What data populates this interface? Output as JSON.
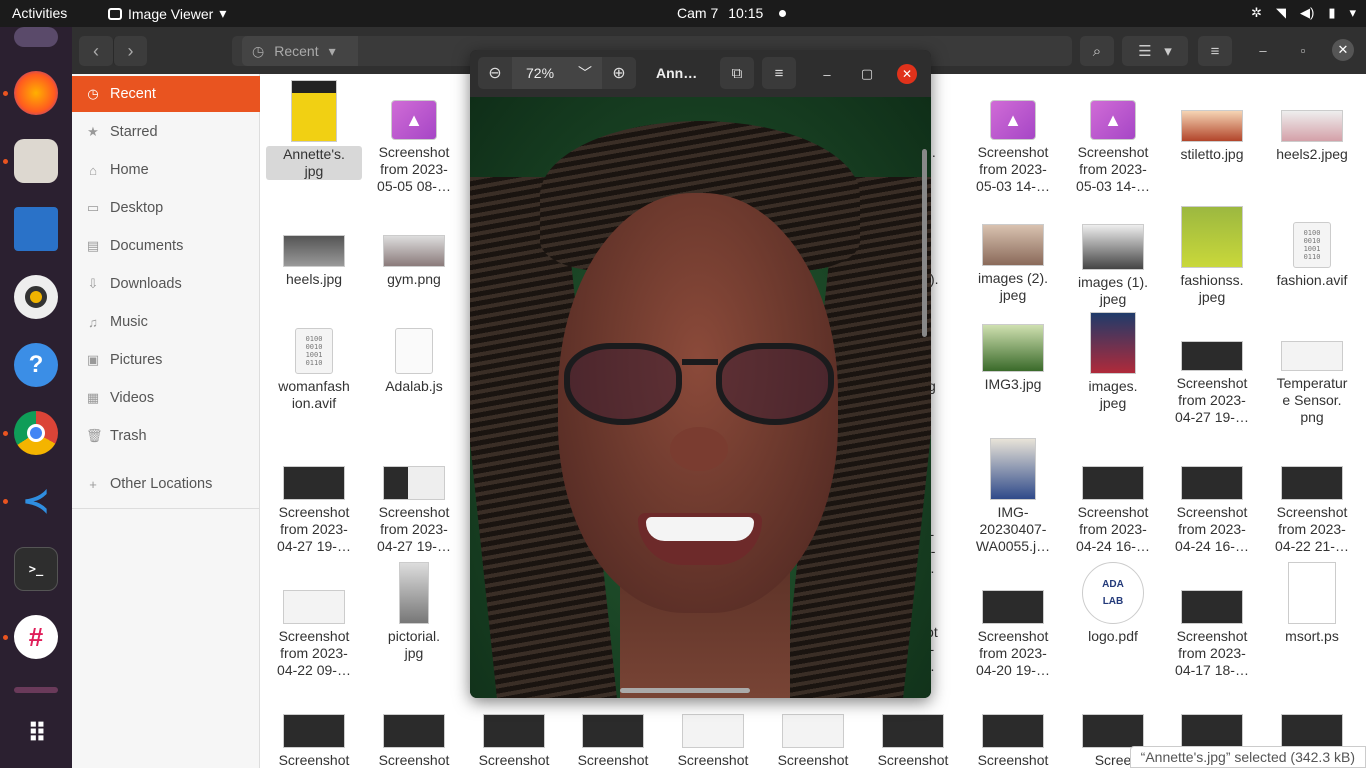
{
  "topbar": {
    "activities": "Activities",
    "app_name": "Image Viewer",
    "clock_label": "Cam 7",
    "clock_time": "10:15"
  },
  "dock": {
    "items": [
      "ubuntu-software-icon",
      "firefox-icon",
      "files-icon",
      "libreoffice-writer-icon",
      "rhythmbox-icon",
      "help-icon",
      "chrome-icon",
      "vscode-icon",
      "terminal-icon",
      "slack-icon",
      "app-grid-icon"
    ]
  },
  "files_window": {
    "location": "Recent",
    "sidebar": [
      {
        "label": "Recent",
        "icon": "clock-icon"
      },
      {
        "label": "Starred",
        "icon": "star-icon"
      },
      {
        "label": "Home",
        "icon": "home-icon"
      },
      {
        "label": "Desktop",
        "icon": "desktop-icon"
      },
      {
        "label": "Documents",
        "icon": "documents-icon"
      },
      {
        "label": "Downloads",
        "icon": "download-icon"
      },
      {
        "label": "Music",
        "icon": "music-icon"
      },
      {
        "label": "Pictures",
        "icon": "pictures-icon"
      },
      {
        "label": "Videos",
        "icon": "videos-icon"
      },
      {
        "label": "Trash",
        "icon": "trash-icon"
      },
      {
        "label": "Other Locations",
        "icon": "plus-icon"
      }
    ],
    "files": [
      {
        "name": "Annette's.\njpg"
      },
      {
        "name": "Screenshot\nfrom 2023-\n05-05 08-…"
      },
      {
        "name": "ug."
      },
      {
        "name": "Screenshot\nfrom 2023-\n05-03 14-…"
      },
      {
        "name": "Screenshot\nfrom 2023-\n05-03 14-…"
      },
      {
        "name": "stiletto.jpg"
      },
      {
        "name": "heels2.jpeg"
      },
      {
        "name": "heels.jpg"
      },
      {
        "name": "gym.png"
      },
      {
        "name": "(3)."
      },
      {
        "name": "images (2).\njpeg"
      },
      {
        "name": "images (1).\njpeg"
      },
      {
        "name": "fashionss.\njpeg"
      },
      {
        "name": "fashion.avif"
      },
      {
        "name": "womanfash\nion.avif"
      },
      {
        "name": "Adalab.js"
      },
      {
        "name": "og"
      },
      {
        "name": "IMG3.jpg"
      },
      {
        "name": "images.\njpeg"
      },
      {
        "name": "Screenshot\nfrom 2023-\n04-27 19-…"
      },
      {
        "name": "Temperatur\ne Sensor.\npng"
      },
      {
        "name": "Screenshot\nfrom 2023-\n04-27 19-…"
      },
      {
        "name": "Screenshot\nfrom 2023-\n04-27 19-…"
      },
      {
        "name": "e-\nis-\n…"
      },
      {
        "name": "IMG-\n20230407-\nWA0055.j…"
      },
      {
        "name": "Screenshot\nfrom 2023-\n04-24 16-…"
      },
      {
        "name": "Screenshot\nfrom 2023-\n04-24 16-…"
      },
      {
        "name": "Screenshot\nfrom 2023-\n04-22 21-…"
      },
      {
        "name": "Screenshot\nfrom 2023-\n04-22 09-…"
      },
      {
        "name": "pictorial.\njpg"
      },
      {
        "name": "hot\n3-\n…"
      },
      {
        "name": "Screenshot\nfrom 2023-\n04-20 19-…"
      },
      {
        "name": "logo.pdf"
      },
      {
        "name": "Screenshot\nfrom 2023-\n04-17 18-…"
      },
      {
        "name": "msort.ps"
      },
      {
        "name": "Screenshot"
      },
      {
        "name": "Screenshot"
      },
      {
        "name": "Screenshot"
      },
      {
        "name": "Screenshot"
      },
      {
        "name": "Screenshot"
      },
      {
        "name": "Screenshot"
      },
      {
        "name": "Screenshot"
      },
      {
        "name": "Screenshot"
      },
      {
        "name": "Scree"
      }
    ],
    "status": "“Annette's.jpg” selected  (342.3 kB)"
  },
  "viewer": {
    "zoom": "72%",
    "title": "Ann…"
  }
}
